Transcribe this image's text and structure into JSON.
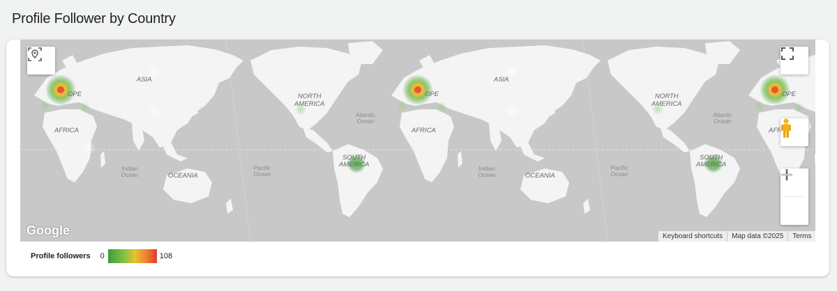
{
  "page": {
    "title": "Profile Follower by Country"
  },
  "map": {
    "continent_labels": {
      "asia": "ASIA",
      "europe": "OPE",
      "africa": "AFRICA",
      "oceania": "OCEANIA",
      "north_america_1": "NORTH",
      "north_america_2": "AMERICA",
      "south_america_1": "SOUTH",
      "south_america_2": "AMERICA",
      "africa_partial": "AFR"
    },
    "ocean_labels": {
      "indian_1": "Indian",
      "indian_2": "Ocean",
      "pacific_1": "Pacific",
      "pacific_2": "Ocean",
      "atlantic_1": "Atlantic",
      "atlantic_2": "Ocean"
    },
    "google_logo": "Google",
    "attribution": {
      "shortcuts": "Keyboard shortcuts",
      "map_data": "Map data ©2025",
      "terms": "Terms"
    },
    "controls": {
      "locate": "locate-icon",
      "fullscreen": "fullscreen-icon",
      "pegman": "pegman-icon",
      "zoom_in": "plus-icon",
      "zoom_out": "minus-icon"
    },
    "colors": {
      "water": "#c8c8c8",
      "land": "#f4f4f4",
      "heat_high": "#e03a2e",
      "heat_mid": "#f0a030",
      "heat_low": "#3e9a3e"
    }
  },
  "legend": {
    "title": "Profile followers",
    "min": "0",
    "max": "108"
  }
}
